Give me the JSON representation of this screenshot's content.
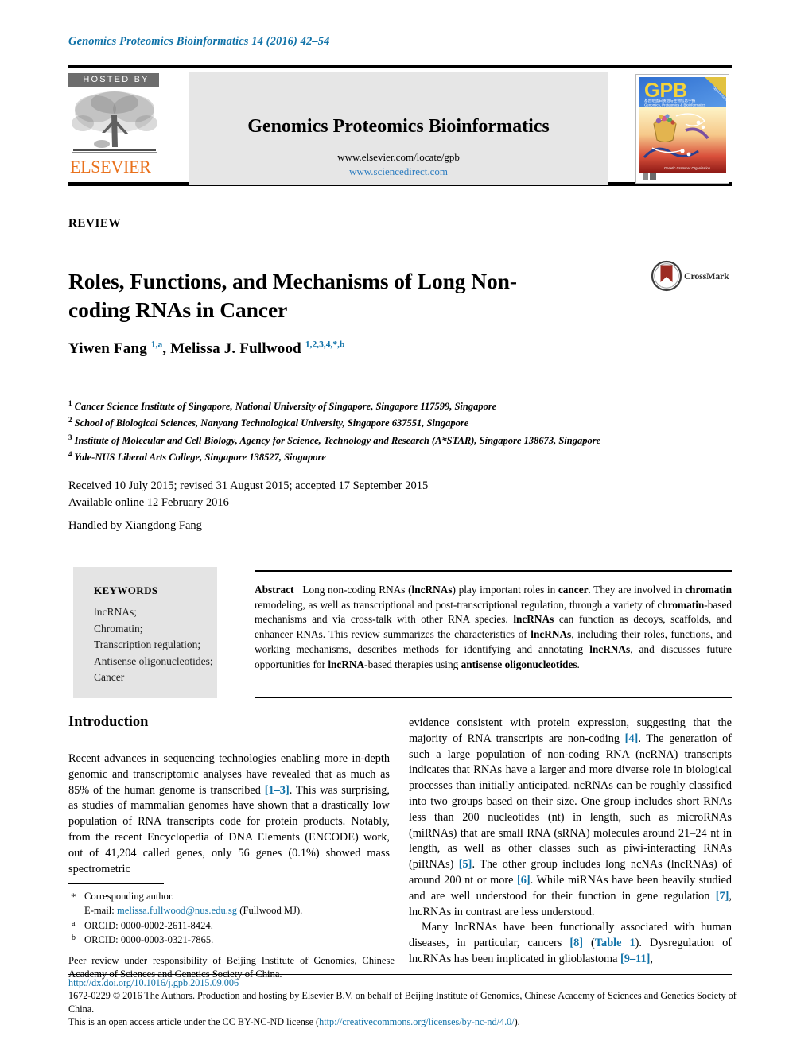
{
  "running_head": "Genomics Proteomics Bioinformatics 14 (2016) 42–54",
  "header": {
    "hosted_by": "HOSTED BY",
    "publisher": "ELSEVIER",
    "journal_name": "Genomics Proteomics Bioinformatics",
    "url_locate": "www.elsevier.com/locate/gpb",
    "url_sciencedirect": "www.sciencedirect.com",
    "cover": {
      "title": "GPB",
      "subtitle_cn": "基因组蛋白质组与生物信息学报",
      "subtitle_en": "Genomics, Proteomics & Bioinformatics",
      "corner_badge": "Open Access",
      "footer_caption": "Genetic Grammar Organization"
    },
    "link_color": "#2f7ec1",
    "elsevier_color": "#E9711C"
  },
  "article": {
    "type": "REVIEW",
    "title": "Roles, Functions, and Mechanisms of Long Non-coding RNAs in Cancer",
    "crossmark_label": "CrossMark",
    "authors_html": "Yiwen Fang <sup>1,a</sup>, Melissa J. Fullwood <sup>1,2,3,4,*,b</sup>",
    "affiliations": [
      {
        "mark": "1",
        "text": "Cancer Science Institute of Singapore, National University of Singapore, Singapore 117599, Singapore"
      },
      {
        "mark": "2",
        "text": "School of Biological Sciences, Nanyang Technological University, Singapore 637551, Singapore"
      },
      {
        "mark": "3",
        "text": "Institute of Molecular and Cell Biology, Agency for Science, Technology and Research (A*STAR), Singapore 138673, Singapore"
      },
      {
        "mark": "4",
        "text": "Yale-NUS Liberal Arts College, Singapore 138527, Singapore"
      }
    ],
    "history_line1": "Received 10 July 2015; revised 31 August 2015; accepted 17 September 2015",
    "history_line2": "Available online 12 February 2016",
    "handled_by": "Handled by Xiangdong Fang"
  },
  "keywords": {
    "heading": "KEYWORDS",
    "items": "lncRNAs;\nChromatin;\nTranscription regulation;\nAntisense oligonucleotides;\nCancer"
  },
  "abstract": {
    "label": "Abstract",
    "text": "Long non-coding RNAs (lncRNAs) play important roles in cancer. They are involved in chromatin remodeling, as well as transcriptional and post-transcriptional regulation, through a variety of chromatin-based mechanisms and via cross-talk with other RNA species. lncRNAs can function as decoys, scaffolds, and enhancer RNAs. This review summarizes the characteristics of lncRNAs, including their roles, functions, and working mechanisms, describes methods for identifying and annotating lncRNAs, and discusses future opportunities for lncRNA-based therapies using antisense oligonucleotides."
  },
  "body": {
    "section_heading": "Introduction",
    "left_paragraph": "Recent advances in sequencing technologies enabling more in-depth genomic and transcriptomic analyses have revealed that as much as 85% of the human genome is transcribed [1–3]. This was surprising, as studies of mammalian genomes have shown that a drastically low population of RNA transcripts code for protein products. Notably, from the recent Encyclopedia of DNA Elements (ENCODE) work, out of 41,204 called genes, only 56 genes (0.1%) showed mass spectrometric",
    "right_paragraph_1": "evidence consistent with protein expression, suggesting that the majority of RNA transcripts are non-coding [4]. The generation of such a large population of non-coding RNA (ncRNA) transcripts indicates that RNAs have a larger and more diverse role in biological processes than initially anticipated. ncRNAs can be roughly classified into two groups based on their size. One group includes short RNAs less than 200 nucleotides (nt) in length, such as microRNAs (miRNAs) that are small RNA (sRNA) molecules around 21–24 nt in length, as well as other classes such as piwi-interacting RNAs (piRNAs) [5]. The other group includes long ncNAs (lncRNAs) of around 200 nt or more [6]. While miRNAs have been heavily studied and are well understood for their function in gene regulation [7], lncRNAs in contrast are less understood.",
    "right_paragraph_2": "Many lncRNAs have been functionally associated with human diseases, in particular, cancers [8] (Table 1). Dysregulation of lncRNAs has been implicated in glioblastoma [9–11],"
  },
  "footnotes": {
    "corresponding": "Corresponding author.",
    "email_prefix": "E-mail:",
    "email": "melissa.fullwood@nus.edu.sg",
    "email_suffix": "(Fullwood MJ).",
    "orcid_a_mark": "a",
    "orcid_a": "ORCID: 0000-0002-2611-8424.",
    "orcid_b_mark": "b",
    "orcid_b": "ORCID: 0000-0003-0321-7865.",
    "peer_review": "Peer review under responsibility of Beijing Institute of Genomics, Chinese Academy of Sciences and Genetics Society of China."
  },
  "copyright": {
    "doi": "http://dx.doi.org/10.1016/j.gpb.2015.09.006",
    "line1": "1672-0229 © 2016 The Authors. Production and hosting by Elsevier B.V. on behalf of Beijing Institute of Genomics, Chinese Academy of Sciences and Genetics Society of China.",
    "license_prefix": "This is an open access article under the CC BY-NC-ND license (",
    "license_url": "http://creativecommons.org/licenses/by-nc-nd/4.0/",
    "license_suffix": ")."
  },
  "colors": {
    "link": "#1072a8",
    "header_gray": "#e6e6e6",
    "keyword_gray": "#e4e4e4",
    "hosted_gray": "#6d6d6d"
  }
}
